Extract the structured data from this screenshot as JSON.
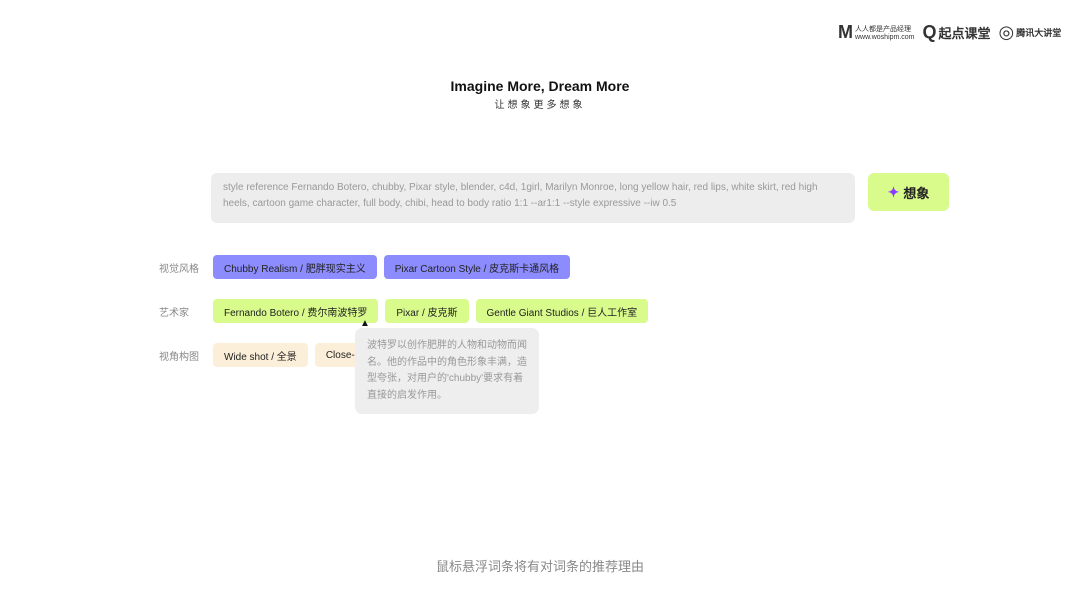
{
  "logos": [
    {
      "mark": "M",
      "name": "人人都是产品经理",
      "sub": "www.woshipm.com"
    },
    {
      "mark": "Q",
      "name": "起点课堂"
    },
    {
      "mark": "◎",
      "name": "腾讯大讲堂"
    }
  ],
  "header": {
    "title": "Imagine More, Dream More",
    "subtitle": "让想象更多想象"
  },
  "prompt": {
    "value": "style reference Fernando Botero, chubby, Pixar style, blender, c4d, 1girl, Marilyn Monroe, long yellow hair, red lips, white skirt, red high heels, cartoon game character, full body, chibi, head to body ratio 1:1 --ar1:1 --style expressive --iw 0.5"
  },
  "imagine_button": {
    "label": "想象",
    "icon": "sparkle-icon"
  },
  "rows": [
    {
      "label": "视觉风格",
      "chips": [
        "Chubby Realism / 肥胖现实主义",
        "Pixar Cartoon Style / 皮克斯卡通风格"
      ]
    },
    {
      "label": "艺术家",
      "chips": [
        "Fernando Botero / 费尔南波特罗",
        "Pixar / 皮克斯",
        "Gentle Giant Studios / 巨人工作室"
      ]
    },
    {
      "label": "视角构图",
      "chips": [
        "Wide shot / 全景",
        "Close-"
      ]
    }
  ],
  "tooltip": "波特罗以创作肥胖的人物和动物而闻名。他的作品中的角色形象丰满，造型夸张，对用户的'chubby'要求有着直接的启发作用。",
  "footer": "鼠标悬浮词条将有对词条的推荐理由",
  "colors": {
    "style": "#8c8cff",
    "artist": "#d9fb8c",
    "composition": "#fcefd9",
    "accent": "#8b3dff"
  }
}
